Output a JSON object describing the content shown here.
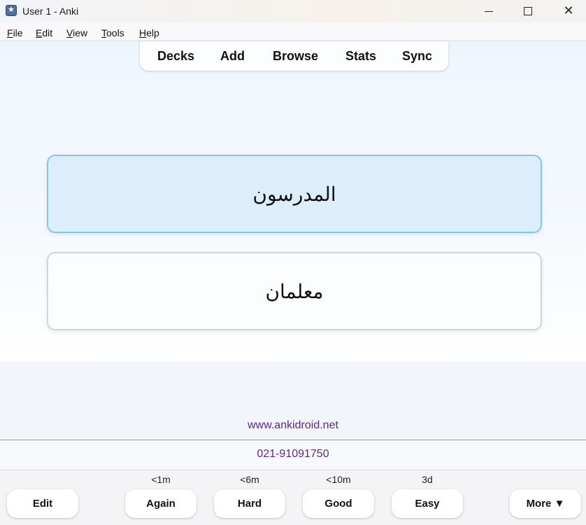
{
  "window": {
    "title": "User 1 - Anki",
    "icon": "anki-star-icon",
    "minimize_icon": "minimize-icon",
    "maximize_icon": "maximize-icon",
    "close_glyph": "✕"
  },
  "menu": {
    "items": [
      {
        "key": "F",
        "rest": "ile"
      },
      {
        "key": "E",
        "rest": "dit"
      },
      {
        "key": "V",
        "rest": "iew"
      },
      {
        "key": "T",
        "rest": "ools"
      },
      {
        "key": "H",
        "rest": "elp"
      }
    ]
  },
  "toolbar": {
    "decks": "Decks",
    "add": "Add",
    "browse": "Browse",
    "stats": "Stats",
    "sync": "Sync"
  },
  "card": {
    "front": "المدرسون",
    "back": "معلمان"
  },
  "links": {
    "site": "www.ankidroid.net",
    "phone": "021-91091750"
  },
  "bottom": {
    "edit": "Edit",
    "more": "More ▼",
    "answers": [
      {
        "interval": "<1m",
        "label": "Again"
      },
      {
        "interval": "<6m",
        "label": "Hard"
      },
      {
        "interval": "<10m",
        "label": "Good"
      },
      {
        "interval": "3d",
        "label": "Easy"
      }
    ]
  },
  "colors": {
    "card_front_bg": "#dcedfc",
    "card_front_border": "#8cc3e3",
    "link": "#5b2a86"
  }
}
